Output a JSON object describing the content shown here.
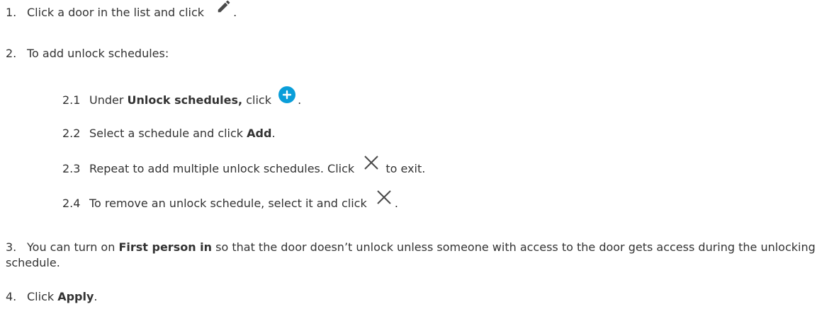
{
  "steps": {
    "s1": {
      "num": "1.",
      "text": "Click a door in the list and click",
      "end": "."
    },
    "s2": {
      "num": "2.",
      "text": "To add unlock schedules:"
    },
    "s2_1": {
      "num": "2.1",
      "pre": "Under",
      "bold": "Unlock schedules,",
      "post": "click",
      "end": "."
    },
    "s2_2": {
      "num": "2.2",
      "pre": "Select a schedule and click",
      "bold": "Add",
      "end": "."
    },
    "s2_3": {
      "num": "2.3",
      "pre": "Repeat to add multiple unlock schedules. Click",
      "post": "to exit."
    },
    "s2_4": {
      "num": "2.4",
      "pre": "To remove an unlock schedule, select it and click",
      "end": "."
    },
    "s3": {
      "num": "3.",
      "pre": "You can turn on",
      "bold": "First person in",
      "post": "so that the door doesn’t unlock unless someone with access to the door gets access during the unlocking schedule."
    },
    "s4": {
      "num": "4.",
      "pre": "Click",
      "bold": "Apply",
      "end": "."
    }
  },
  "icons": {
    "edit": "pencil-icon",
    "add": "plus-circle-icon",
    "close": "close-x-icon",
    "accent": "#0a9ed9",
    "icon_color": "#4a4a4a"
  }
}
